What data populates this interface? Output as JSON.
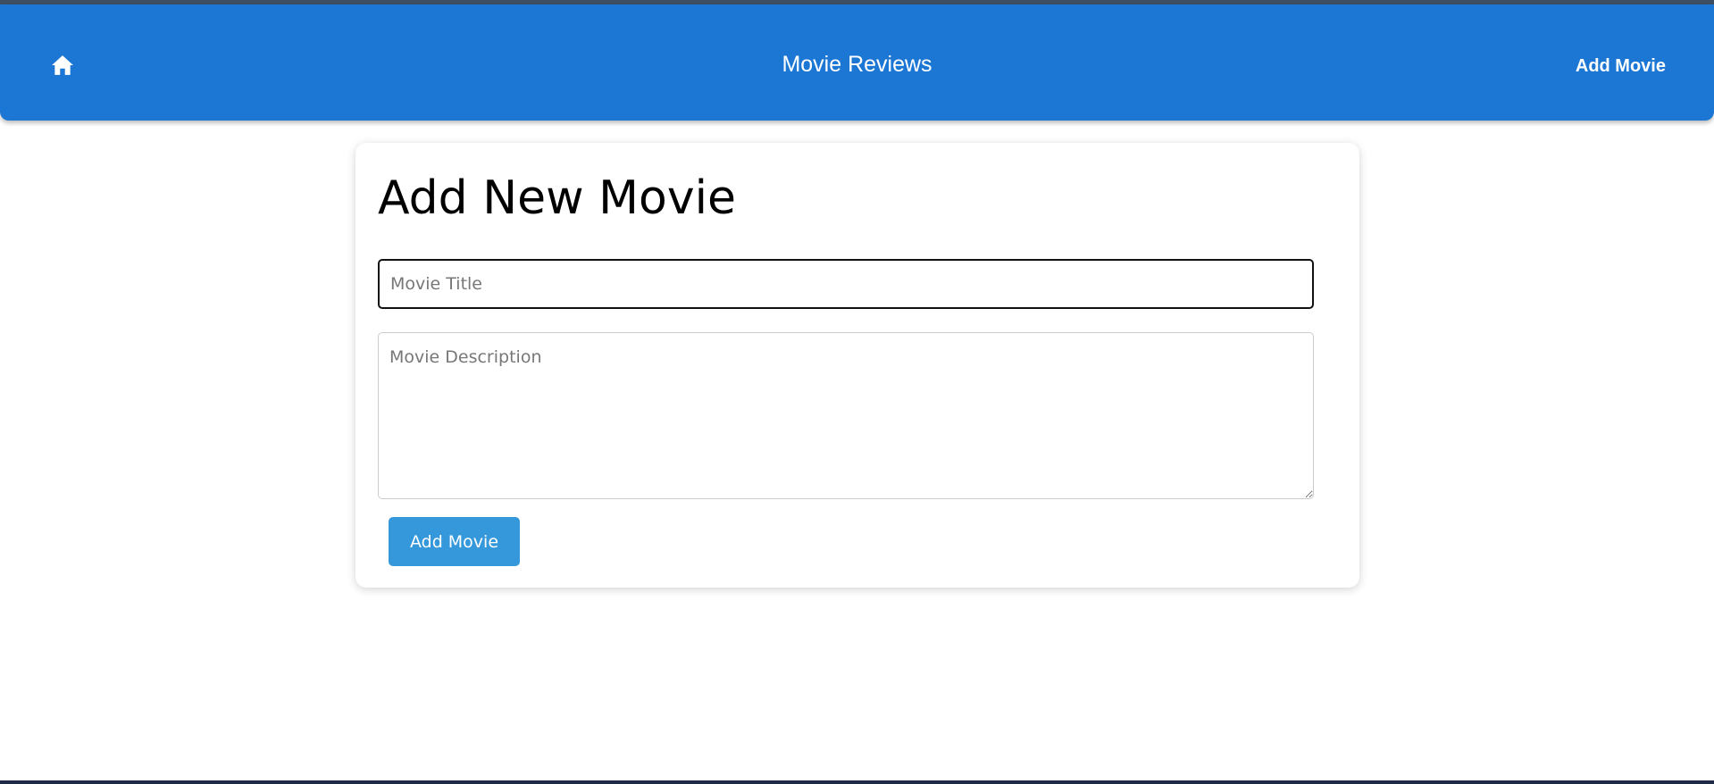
{
  "header": {
    "home_icon": "home-icon",
    "title": "Movie Reviews",
    "nav_add_label": "Add Movie",
    "background_color": "#1b76d4"
  },
  "form": {
    "heading": "Add New Movie",
    "title_input": {
      "placeholder": "Movie Title",
      "value": ""
    },
    "description_input": {
      "placeholder": "Movie Description",
      "value": ""
    },
    "submit_label": "Add Movie",
    "submit_color": "#3498db"
  }
}
